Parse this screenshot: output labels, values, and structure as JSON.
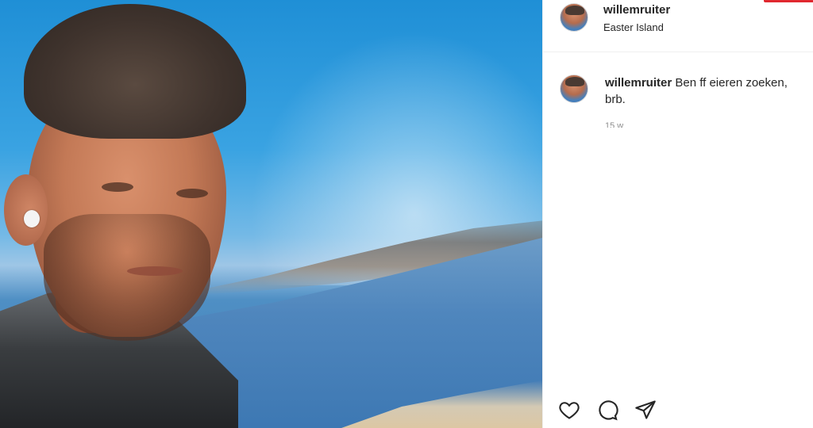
{
  "post": {
    "username": "willemruiter",
    "location": "Easter Island",
    "photo_alt": "Selfie of a man by a lake under a blue sky"
  },
  "comment": {
    "username": "willemruiter",
    "text": "Ben ff eieren zoeken, brb.",
    "timestamp": "15 w"
  },
  "actions": [
    {
      "name": "like-button",
      "icon": "heart-icon"
    },
    {
      "name": "comment-button",
      "icon": "comment-bubble-icon"
    },
    {
      "name": "share-button",
      "icon": "paper-plane-icon"
    }
  ],
  "colors": {
    "text": "#262626",
    "muted": "#8e8e8e",
    "border": "#efefef",
    "accent_red": "#e0282f"
  }
}
